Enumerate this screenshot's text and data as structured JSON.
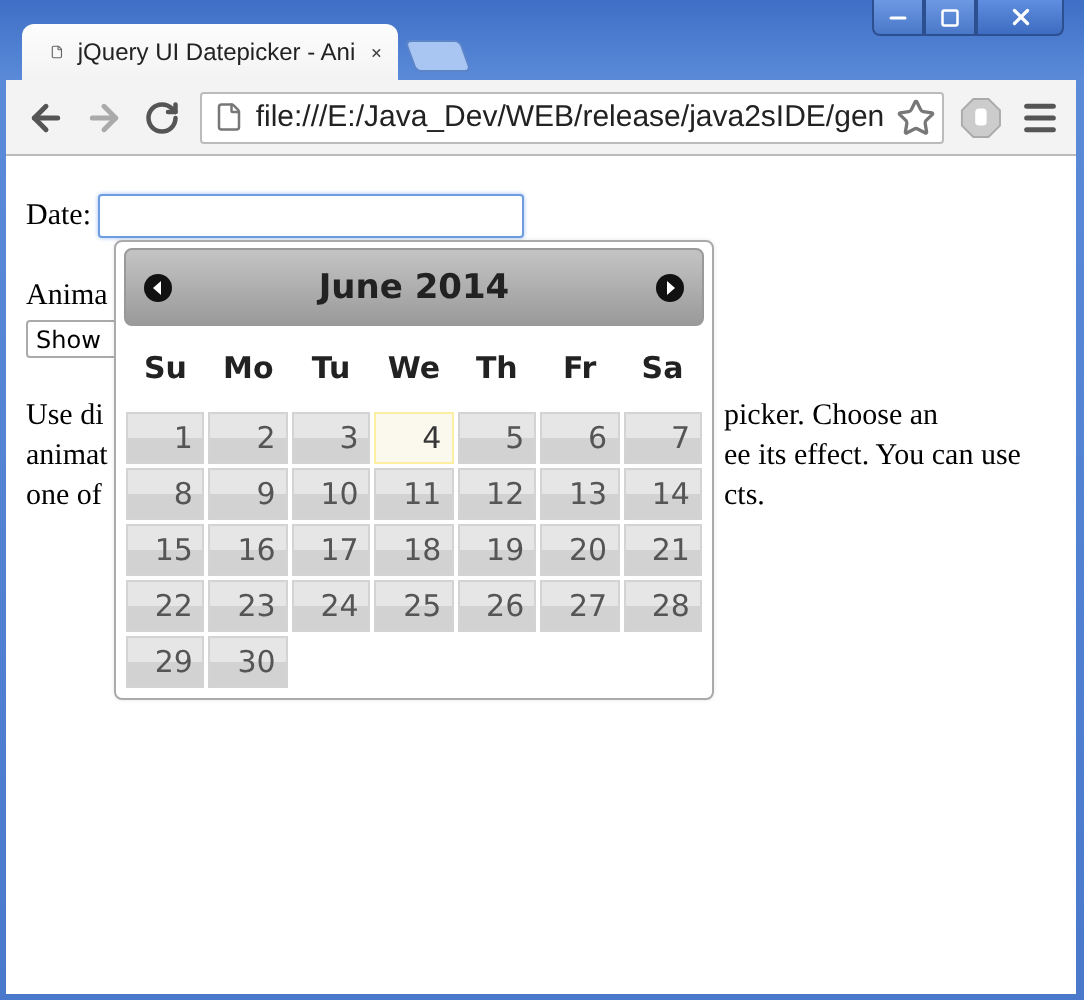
{
  "window": {
    "tab_title": "jQuery UI Datepicker - Ani"
  },
  "toolbar": {
    "url": "file:///E:/Java_Dev/WEB/release/java2sIDE/gen"
  },
  "page": {
    "date_label": "Date:",
    "animation_label": "Anima",
    "animation_select": "Show",
    "paragraph_lines": [
      {
        "left": "Use di",
        "right": "picker. Choose an"
      },
      {
        "left": "animat",
        "right": "ee its effect. You can use"
      },
      {
        "left": "one of",
        "right": "cts."
      }
    ]
  },
  "datepicker": {
    "title": "June 2014",
    "weekdays": [
      "Su",
      "Mo",
      "Tu",
      "We",
      "Th",
      "Fr",
      "Sa"
    ],
    "days": [
      {
        "label": "1",
        "today": false
      },
      {
        "label": "2",
        "today": false
      },
      {
        "label": "3",
        "today": false
      },
      {
        "label": "4",
        "today": true
      },
      {
        "label": "5",
        "today": false
      },
      {
        "label": "6",
        "today": false
      },
      {
        "label": "7",
        "today": false
      },
      {
        "label": "8",
        "today": false
      },
      {
        "label": "9",
        "today": false
      },
      {
        "label": "10",
        "today": false
      },
      {
        "label": "11",
        "today": false
      },
      {
        "label": "12",
        "today": false
      },
      {
        "label": "13",
        "today": false
      },
      {
        "label": "14",
        "today": false
      },
      {
        "label": "15",
        "today": false
      },
      {
        "label": "16",
        "today": false
      },
      {
        "label": "17",
        "today": false
      },
      {
        "label": "18",
        "today": false
      },
      {
        "label": "19",
        "today": false
      },
      {
        "label": "20",
        "today": false
      },
      {
        "label": "21",
        "today": false
      },
      {
        "label": "22",
        "today": false
      },
      {
        "label": "23",
        "today": false
      },
      {
        "label": "24",
        "today": false
      },
      {
        "label": "25",
        "today": false
      },
      {
        "label": "26",
        "today": false
      },
      {
        "label": "27",
        "today": false
      },
      {
        "label": "28",
        "today": false
      },
      {
        "label": "29",
        "today": false
      },
      {
        "label": "30",
        "today": false
      }
    ]
  }
}
